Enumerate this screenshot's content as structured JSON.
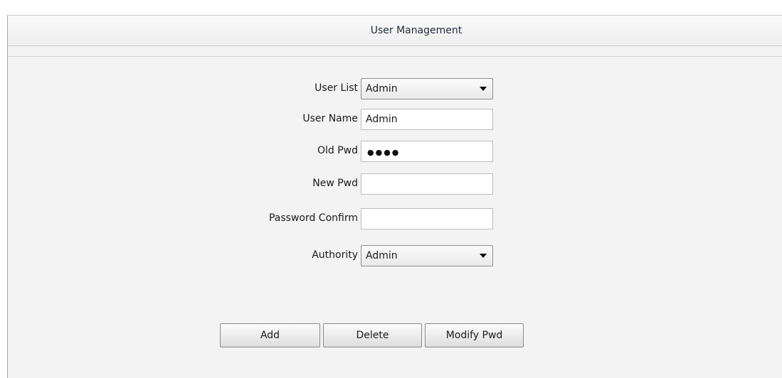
{
  "header": {
    "title": "User Management"
  },
  "form": {
    "user_list": {
      "label": "User List",
      "selected": "Admin"
    },
    "user_name": {
      "label": "User Name",
      "value": "Admin"
    },
    "old_pwd": {
      "label": "Old Pwd",
      "masked": "●●●●"
    },
    "new_pwd": {
      "label": "New Pwd",
      "value": ""
    },
    "password_confirm": {
      "label": "Password Confirm",
      "value": ""
    },
    "authority": {
      "label": "Authority",
      "selected": "Admin"
    }
  },
  "buttons": {
    "add": "Add",
    "delete": "Delete",
    "modify_pwd": "Modify Pwd"
  }
}
